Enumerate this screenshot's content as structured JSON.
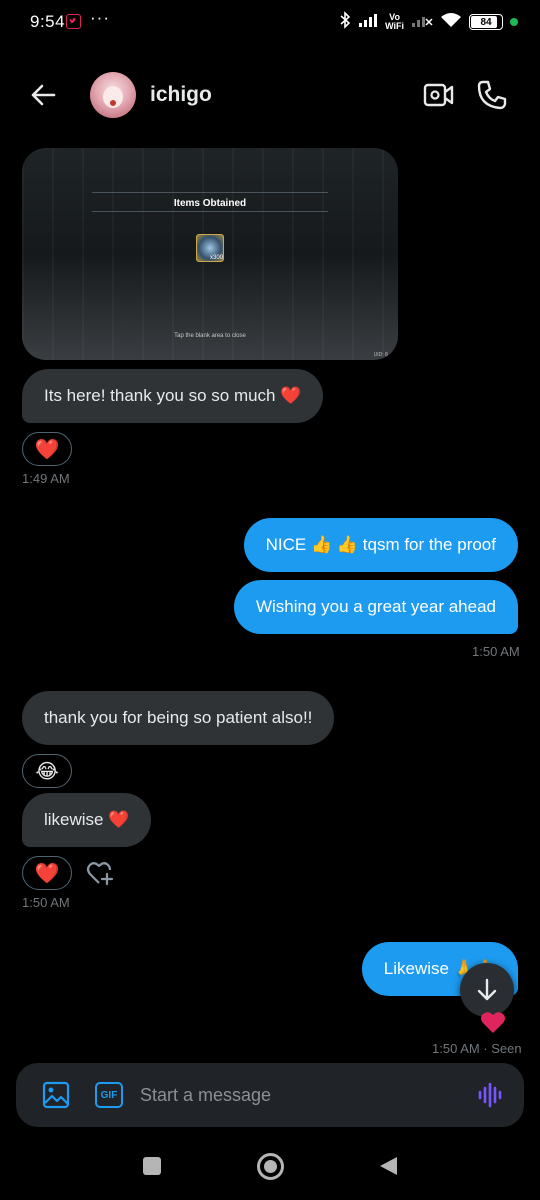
{
  "status_bar": {
    "time": "9:54",
    "dots": "···",
    "vowifi_top": "Vo",
    "vowifi_bottom": "WiFi",
    "battery": "84"
  },
  "header": {
    "contact_name": "ichigo",
    "icons": [
      "back-arrow-icon",
      "avatar",
      "video-call-icon",
      "phone-icon"
    ]
  },
  "image_message": {
    "title": "Items Obtained",
    "item_count": "x300",
    "tap_text": "Tap the blank area to close",
    "uid_text": "UID: 8..."
  },
  "messages": [
    {
      "side": "incoming",
      "text": "Its here! thank you so so much ❤️"
    },
    {
      "side": "outgoing",
      "text": "NICE 👍 👍 tqsm for the proof"
    },
    {
      "side": "outgoing",
      "text": "Wishing you a great year ahead"
    },
    {
      "side": "incoming",
      "text": "thank you for being so patient also!!"
    },
    {
      "side": "incoming",
      "text": "likewise ❤️"
    },
    {
      "side": "outgoing",
      "text": "Likewise 🙏🙏"
    }
  ],
  "reactions": {
    "r1": "❤️",
    "r2": "😂",
    "r3": "❤️"
  },
  "timestamps": {
    "t1": "1:49 AM",
    "t2": "1:50 AM",
    "t3": "1:50 AM",
    "t4": "1:50 AM · Seen"
  },
  "composer": {
    "placeholder": "Start a message",
    "gif_label": "GIF"
  },
  "colors": {
    "accent": "#1d9bf0",
    "incoming_bubble": "#2f3336",
    "background": "#000000",
    "heart": "#e0245e"
  }
}
